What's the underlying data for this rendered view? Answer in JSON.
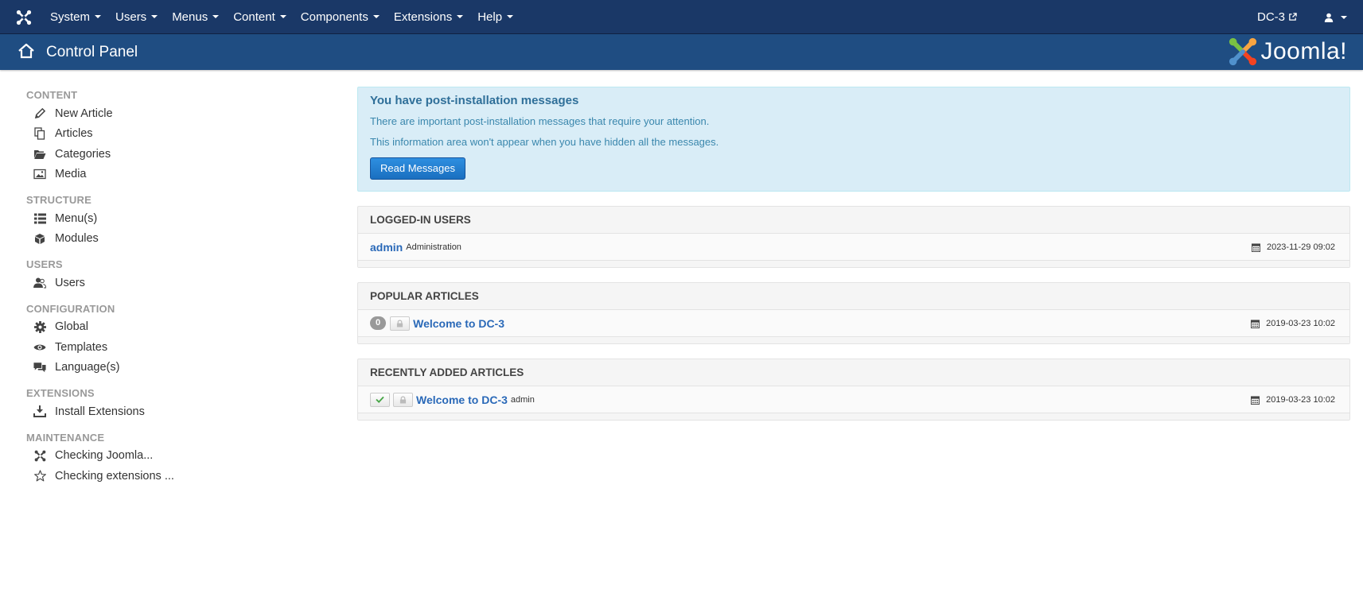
{
  "topnav": {
    "menus": [
      {
        "label": "System"
      },
      {
        "label": "Users"
      },
      {
        "label": "Menus"
      },
      {
        "label": "Content"
      },
      {
        "label": "Components"
      },
      {
        "label": "Extensions"
      },
      {
        "label": "Help"
      }
    ],
    "site_label": "DC-3"
  },
  "subhead": {
    "title": "Control Panel",
    "brand": "Joomla!"
  },
  "sidebar": {
    "sections": [
      {
        "heading": "CONTENT",
        "items": [
          {
            "label": "New Article",
            "icon": "pencil-icon"
          },
          {
            "label": "Articles",
            "icon": "copy-icon"
          },
          {
            "label": "Categories",
            "icon": "folder-open-icon"
          },
          {
            "label": "Media",
            "icon": "image-icon"
          }
        ]
      },
      {
        "heading": "STRUCTURE",
        "items": [
          {
            "label": "Menu(s)",
            "icon": "list-icon"
          },
          {
            "label": "Modules",
            "icon": "cube-icon"
          }
        ]
      },
      {
        "heading": "USERS",
        "items": [
          {
            "label": "Users",
            "icon": "users-icon"
          }
        ]
      },
      {
        "heading": "CONFIGURATION",
        "items": [
          {
            "label": "Global",
            "icon": "cog-icon"
          },
          {
            "label": "Templates",
            "icon": "eye-icon"
          },
          {
            "label": "Language(s)",
            "icon": "comments-icon"
          }
        ]
      },
      {
        "heading": "EXTENSIONS",
        "items": [
          {
            "label": "Install Extensions",
            "icon": "download-icon"
          }
        ]
      },
      {
        "heading": "MAINTENANCE",
        "items": [
          {
            "label": "Checking Joomla...",
            "icon": "joomla-icon"
          },
          {
            "label": "Checking extensions ...",
            "icon": "star-icon"
          }
        ]
      }
    ]
  },
  "alert": {
    "title": "You have post-installation messages",
    "line1": "There are important post-installation messages that require your attention.",
    "line2": "This information area won't appear when you have hidden all the messages.",
    "button": "Read Messages"
  },
  "logged_in": {
    "heading": "LOGGED-IN USERS",
    "user": "admin",
    "role": "Administration",
    "date": "2023-11-29 09:02"
  },
  "popular": {
    "heading": "POPULAR ARTICLES",
    "hits": "0",
    "title": "Welcome to DC-3",
    "date": "2019-03-23 10:02"
  },
  "recent": {
    "heading": "RECENTLY ADDED ARTICLES",
    "title": "Welcome to DC-3",
    "author": "admin",
    "date": "2019-03-23 10:02"
  },
  "colors": {
    "navbar": "#1a3867",
    "subhead": "#1f4d82",
    "link": "#2a69b8",
    "alert_bg": "#d9edf7"
  }
}
